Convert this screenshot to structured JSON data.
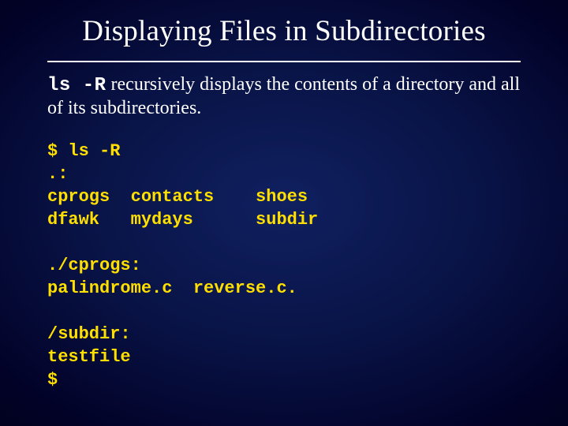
{
  "title": "Displaying Files in Subdirectories",
  "desc": {
    "cmd": "ls -R",
    "text_after": " recursively displays the contents of a directory and all of its subdirectories."
  },
  "terminal": "$ ls -R\n.:\ncprogs  contacts    shoes\ndfawk   mydays      subdir\n\n./cprogs:\npalindrome.c  reverse.c.\n\n/subdir:\ntestfile\n$"
}
